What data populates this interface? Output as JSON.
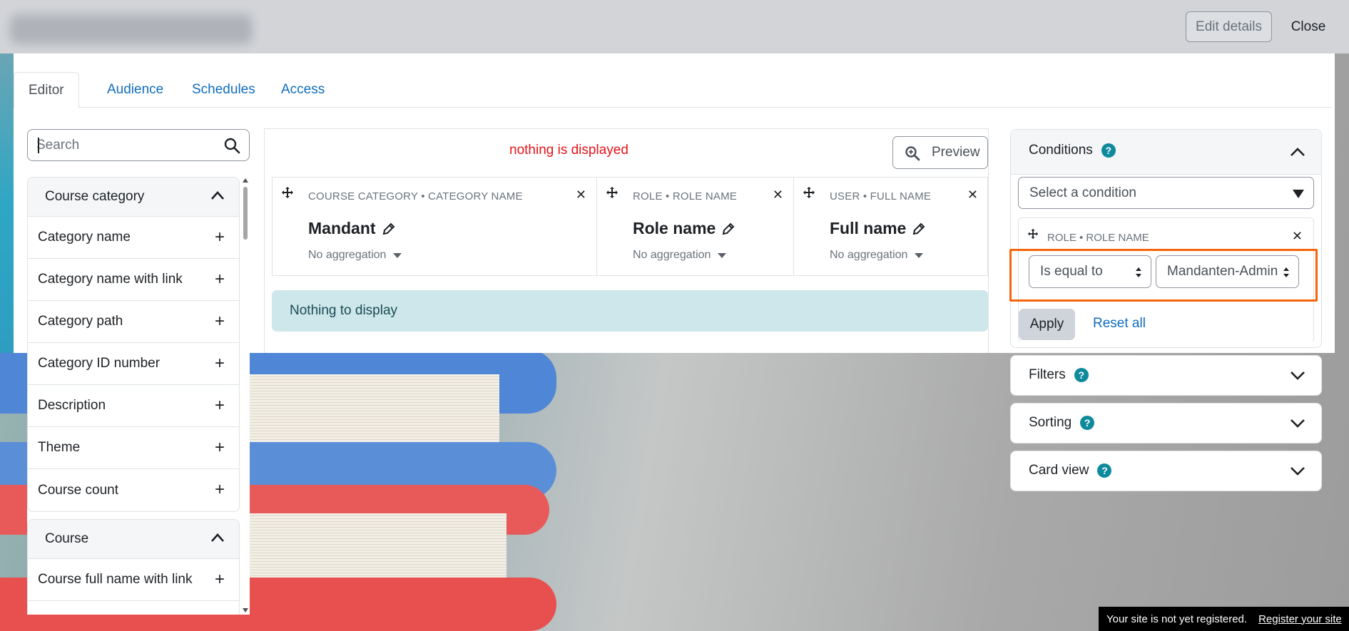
{
  "header": {
    "edit_details_label": "Edit details",
    "close_label": "Close"
  },
  "tabs": [
    {
      "label": "Editor",
      "active": true
    },
    {
      "label": "Audience",
      "active": false
    },
    {
      "label": "Schedules",
      "active": false
    },
    {
      "label": "Access",
      "active": false
    }
  ],
  "sidebar": {
    "search_placeholder": "Search",
    "groups": [
      {
        "title": "Course category",
        "items": [
          "Category name",
          "Category name with link",
          "Category path",
          "Category ID number",
          "Description",
          "Theme",
          "Course count"
        ]
      },
      {
        "title": "Course",
        "items": [
          "Course full name with link"
        ]
      }
    ]
  },
  "main": {
    "note": "nothing is displayed",
    "preview_label": "Preview",
    "columns": [
      {
        "caption": "COURSE CATEGORY • CATEGORY NAME",
        "name": "Mandant",
        "aggregation": "No aggregation"
      },
      {
        "caption": "ROLE • ROLE NAME",
        "name": "Role name",
        "aggregation": "No aggregation"
      },
      {
        "caption": "USER • FULL NAME",
        "name": "Full name",
        "aggregation": "No aggregation"
      }
    ],
    "empty_message": "Nothing to display"
  },
  "conditions": {
    "title": "Conditions",
    "select_placeholder": "Select a condition",
    "item": {
      "caption": "ROLE • ROLE NAME",
      "operator": "Is equal to",
      "value": "Mandanten-Admin"
    },
    "apply_label": "Apply",
    "reset_label": "Reset all"
  },
  "sections": [
    {
      "title": "Filters"
    },
    {
      "title": "Sorting"
    },
    {
      "title": "Card view"
    }
  ],
  "footer": {
    "notice": "Your site is not yet registered.",
    "link": "Register your site"
  },
  "colors": {
    "link": "#0f6cbf",
    "help_badge": "#0f8a9d",
    "highlight": "#f6640b",
    "note_red": "#e8141a",
    "alert_bg": "#cde7ea"
  }
}
